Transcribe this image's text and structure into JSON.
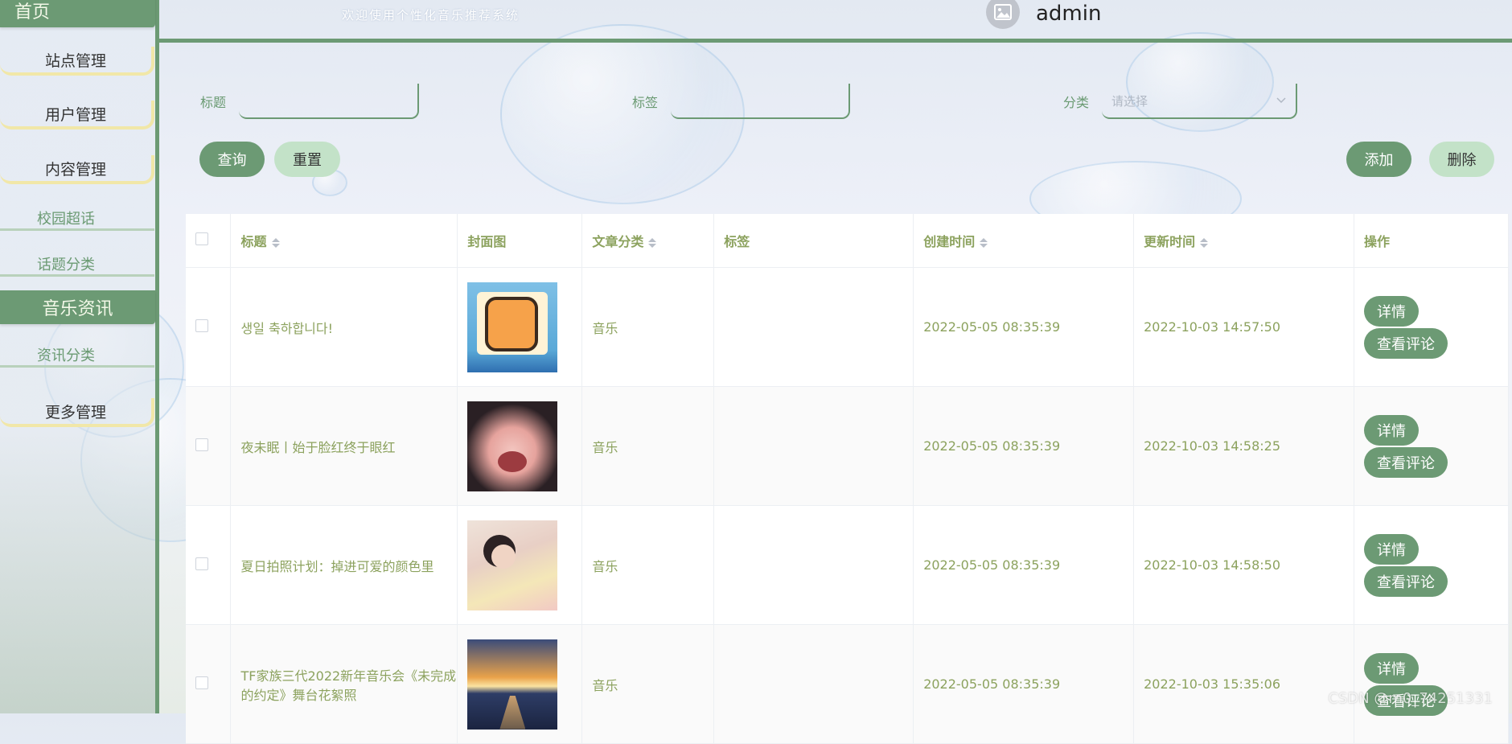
{
  "sidebar": {
    "home_label": "首页",
    "menus": [
      "站点管理",
      "用户管理",
      "内容管理"
    ],
    "sub_items_top": [
      "校园超话",
      "话题分类"
    ],
    "section_label": "音乐资讯",
    "sub_items_music": [
      "资讯分类"
    ],
    "more_label": "更多管理"
  },
  "header": {
    "welcome": "欢迎使用个性化音乐推荐系统",
    "username": "admin"
  },
  "search": {
    "title_label": "标题",
    "tag_label": "标签",
    "category_label": "分类",
    "category_placeholder": "请选择",
    "query_button": "查询",
    "reset_button": "重置",
    "add_button": "添加",
    "delete_button": "删除"
  },
  "table": {
    "columns": [
      "标题",
      "封面图",
      "文章分类",
      "标签",
      "创建时间",
      "更新时间",
      "操作"
    ],
    "rows": [
      {
        "title": "생일 축하합니다!",
        "category": "音乐",
        "tag": "",
        "created": "2022-05-05 08:35:39",
        "updated": "2022-10-03 14:57:50",
        "detail": "详情",
        "comments": "查看评论"
      },
      {
        "title": "夜未眠丨始于脸红终于眼红",
        "category": "音乐",
        "tag": "",
        "created": "2022-05-05 08:35:39",
        "updated": "2022-10-03 14:58:25",
        "detail": "详情",
        "comments": "查看评论"
      },
      {
        "title": "夏日拍照计划：掉进可爱的颜色里",
        "category": "音乐",
        "tag": "",
        "created": "2022-05-05 08:35:39",
        "updated": "2022-10-03 14:58:50",
        "detail": "详情",
        "comments": "查看评论"
      },
      {
        "title": "TF家族三代2022新年音乐会《未完成的约定》舞台花絮照",
        "category": "音乐",
        "tag": "",
        "created": "2022-05-05 08:35:39",
        "updated": "2022-10-03 15:35:06",
        "detail": "详情",
        "comments": "查看评论"
      }
    ]
  },
  "watermark": "CSDN @m0_74251331",
  "colors": {
    "accent": "#6c9a74",
    "accent_light": "#c3e2c8",
    "text_green": "#8ca25e",
    "menu_border": "#f1e7a8"
  }
}
